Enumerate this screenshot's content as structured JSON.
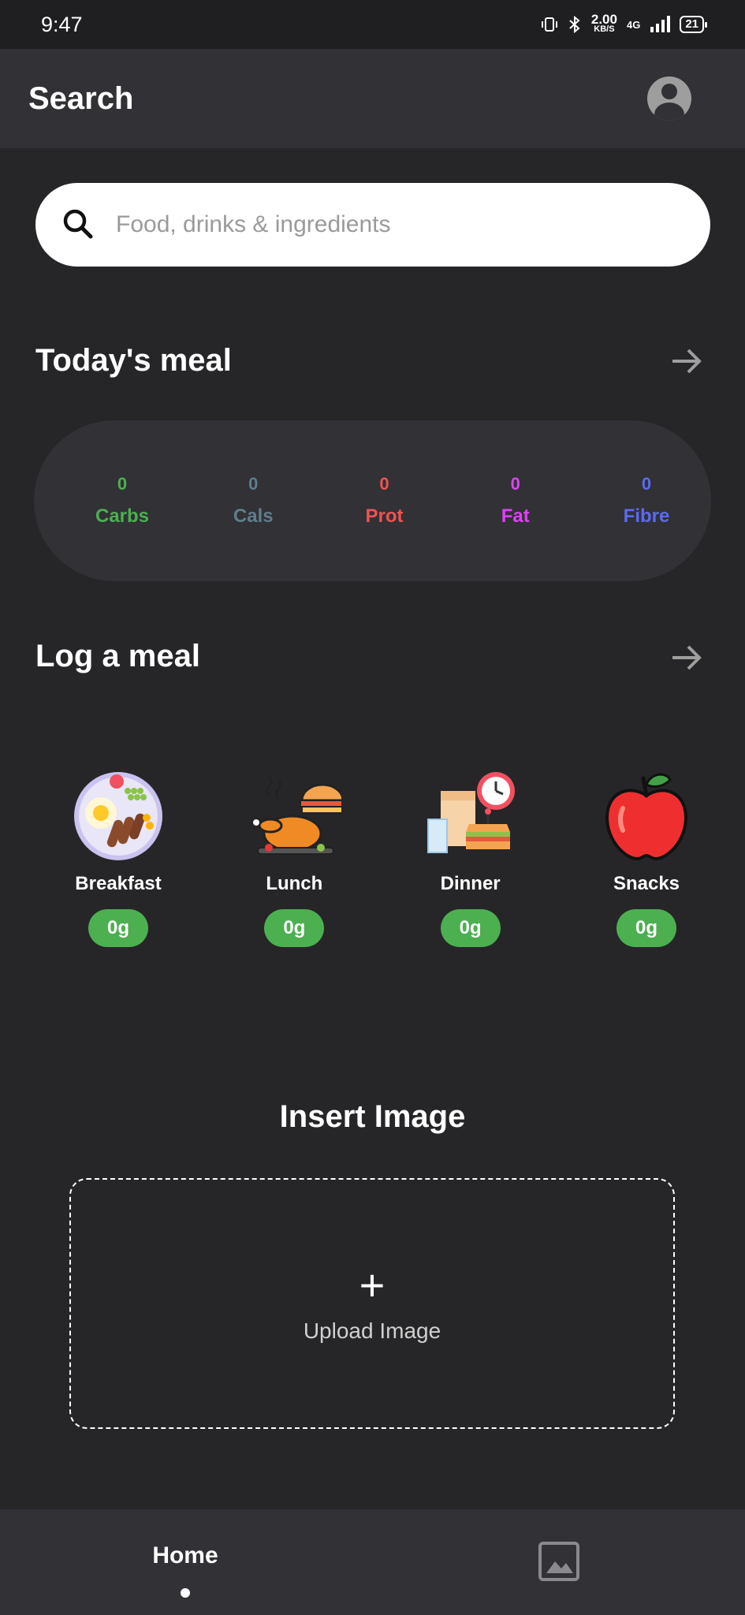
{
  "status_bar": {
    "time": "9:47",
    "net_speed_value": "2.00",
    "net_speed_unit": "KB/S",
    "network": "4G",
    "battery": "21"
  },
  "app_bar": {
    "title": "Search"
  },
  "search": {
    "placeholder": "Food, drinks & ingredients"
  },
  "todays_meal": {
    "title": "Today's meal",
    "macros": [
      {
        "value": "0",
        "label": "Carbs",
        "color": "#4caf50"
      },
      {
        "value": "0",
        "label": "Cals",
        "color": "#607d8b"
      },
      {
        "value": "0",
        "label": "Prot",
        "color": "#ef5350"
      },
      {
        "value": "0",
        "label": "Fat",
        "color": "#e040fb"
      },
      {
        "value": "0",
        "label": "Fibre",
        "color": "#5c6bf0"
      }
    ]
  },
  "log_meal": {
    "title": "Log a meal",
    "meals": [
      {
        "name": "Breakfast",
        "amount": "0g",
        "icon": "breakfast-plate-icon"
      },
      {
        "name": "Lunch",
        "amount": "0g",
        "icon": "roast-chicken-icon"
      },
      {
        "name": "Dinner",
        "amount": "0g",
        "icon": "dinner-clock-icon"
      },
      {
        "name": "Snacks",
        "amount": "0g",
        "icon": "apple-icon"
      }
    ],
    "badge_color": "#4caf50"
  },
  "insert_image": {
    "title": "Insert Image",
    "plus": "+",
    "upload_label": "Upload Image"
  },
  "bottom_nav": {
    "home_label": "Home",
    "gallery_icon": "image-icon"
  }
}
